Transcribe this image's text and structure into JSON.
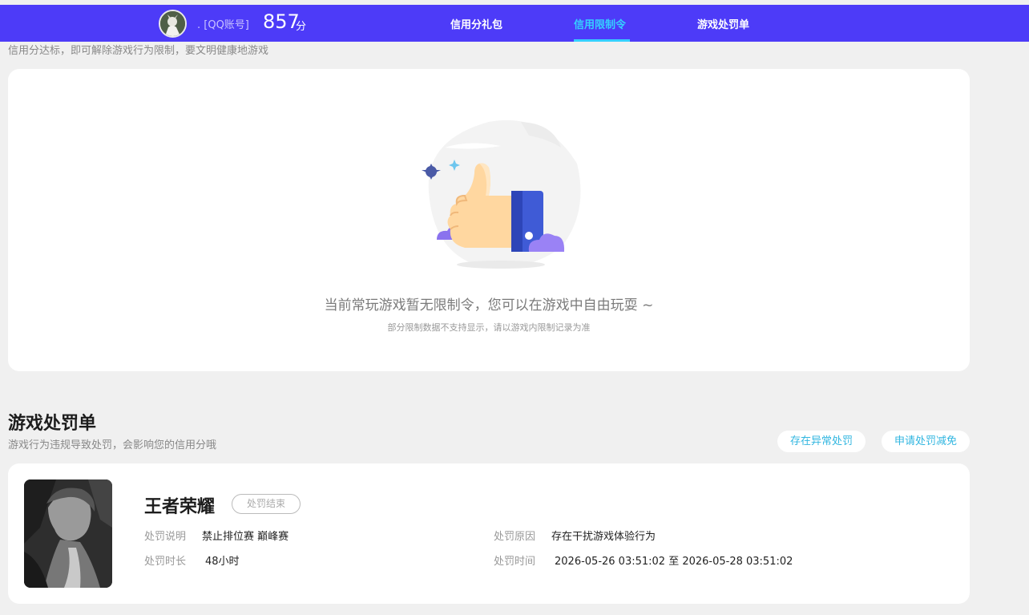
{
  "header": {
    "user_label": ". [QQ账号]",
    "score": "857",
    "score_unit": "分",
    "tabs": [
      {
        "label": "信用分礼包",
        "active": false
      },
      {
        "label": "信用限制令",
        "active": true
      },
      {
        "label": "游戏处罚单",
        "active": false
      }
    ],
    "bar_color": "#4d3bf8",
    "active_color": "#35d0ff"
  },
  "restriction": {
    "note": "信用分达标，即可解除游戏行为限制，要文明健康地游戏",
    "empty_title": "当前常玩游戏暂无限制令，您可以在游戏中自由玩耍 ~",
    "empty_sub": "部分限制数据不支持显示，请以游戏内限制记录为准",
    "illustration_icon": "thumbs-up-icon"
  },
  "penalty": {
    "title": "游戏处罚单",
    "subtitle": "游戏行为违规导致处罚，会影响您的信用分哦",
    "actions": [
      "存在异常处罚",
      "申请处罚减免"
    ],
    "record": {
      "game": "王者荣耀",
      "status": "处罚结束",
      "fields": {
        "desc_label": "处罚说明",
        "desc_value": "禁止排位赛 巅峰赛",
        "duration_label": "处罚时长",
        "duration_value": "48小时",
        "reason_label": "处罚原因",
        "reason_value": "存在干扰游戏体验行为",
        "time_label": "处罚时间",
        "time_value": "2026-05-26 03:51:02 至 2026-05-28 03:51:02"
      }
    }
  }
}
